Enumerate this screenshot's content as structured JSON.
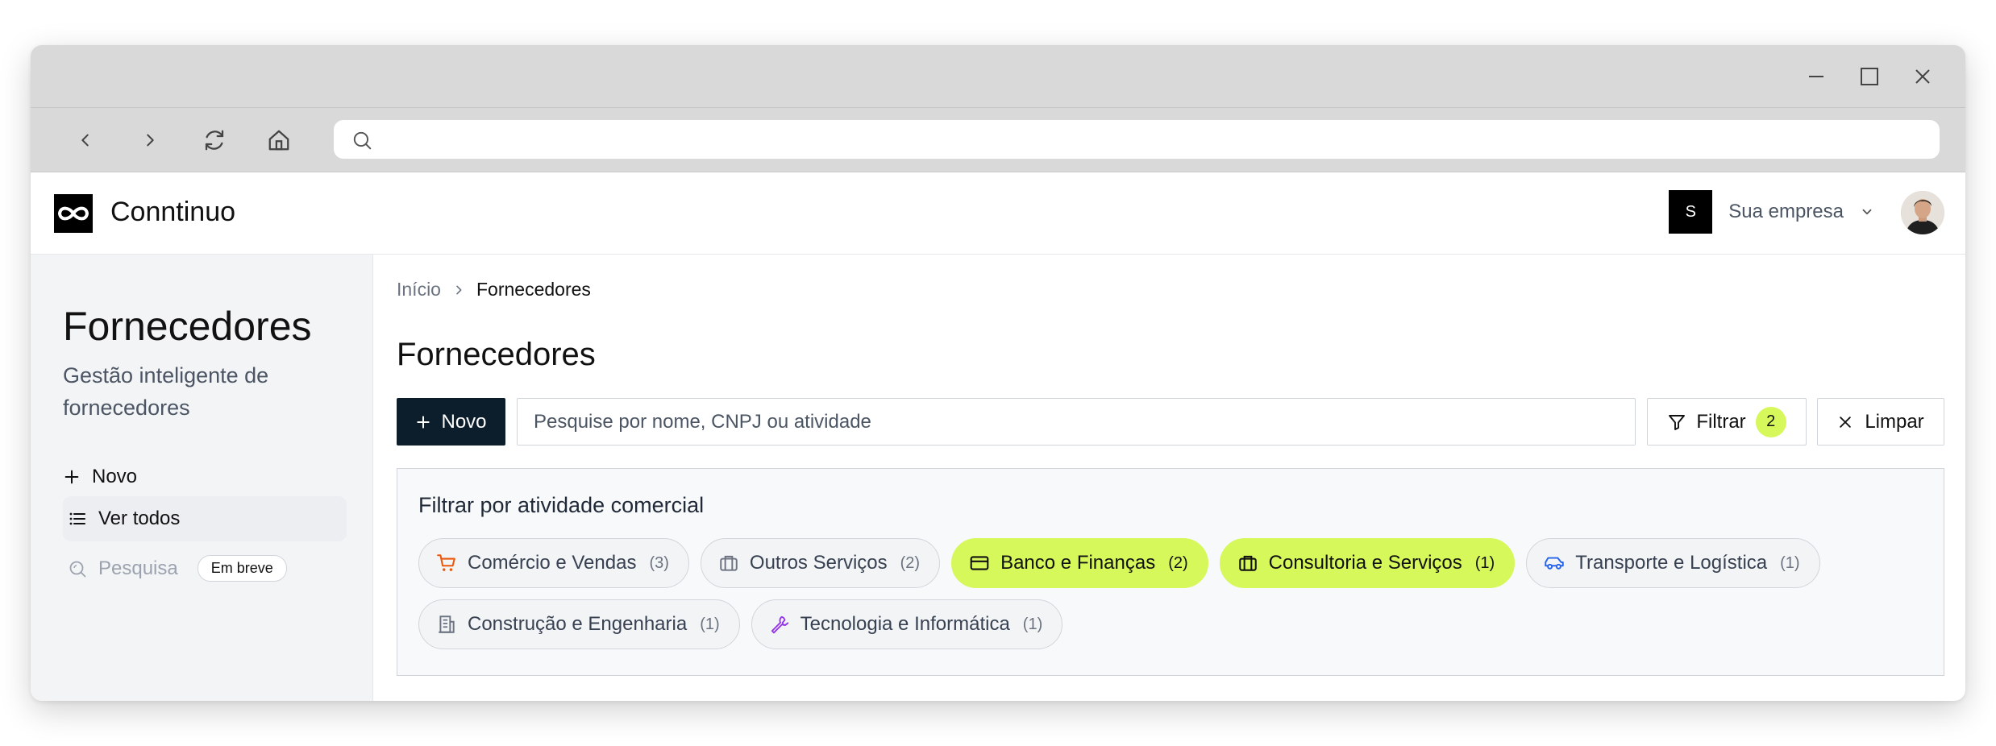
{
  "browser": {
    "address_value": ""
  },
  "app": {
    "brand": "Conntinuo",
    "company_badge": "S",
    "company_name": "Sua empresa"
  },
  "sidebar": {
    "title": "Fornecedores",
    "subtitle": "Gestão inteligente de fornecedores",
    "items": [
      {
        "label": "Novo",
        "icon": "plus-icon"
      },
      {
        "label": "Ver todos",
        "icon": "list-icon"
      },
      {
        "label": "Pesquisa",
        "icon": "search-icon",
        "badge": "Em breve"
      }
    ]
  },
  "breadcrumb": {
    "home": "Início",
    "current": "Fornecedores"
  },
  "main": {
    "title": "Fornecedores",
    "new_label": "Novo",
    "search_placeholder": "Pesquise por nome, CNPJ ou atividade",
    "filter_label": "Filtrar",
    "filter_count": "2",
    "clear_label": "Limpar"
  },
  "filter_panel": {
    "title": "Filtrar por atividade comercial",
    "chips": [
      {
        "label": "Comércio e Vendas",
        "count": "(3)",
        "icon": "cart-icon",
        "icon_color": "#ea580c",
        "selected": false
      },
      {
        "label": "Outros Serviços",
        "count": "(2)",
        "icon": "briefcase-icon",
        "icon_color": "#6b7280",
        "selected": false
      },
      {
        "label": "Banco e Finanças",
        "count": "(2)",
        "icon": "credit-card-icon",
        "icon_color": "#111111",
        "selected": true
      },
      {
        "label": "Consultoria e Serviços",
        "count": "(1)",
        "icon": "briefcase-icon",
        "icon_color": "#111111",
        "selected": true
      },
      {
        "label": "Transporte e Logística",
        "count": "(1)",
        "icon": "car-icon",
        "icon_color": "#2563eb",
        "selected": false
      },
      {
        "label": "Construção e Engenharia",
        "count": "(1)",
        "icon": "building-icon",
        "icon_color": "#6b7280",
        "selected": false
      },
      {
        "label": "Tecnologia e Informática",
        "count": "(1)",
        "icon": "wrench-icon",
        "icon_color": "#9333ea",
        "selected": false
      }
    ]
  },
  "colors": {
    "accent": "#d6f85a",
    "primary_button": "#0c1d2b"
  }
}
